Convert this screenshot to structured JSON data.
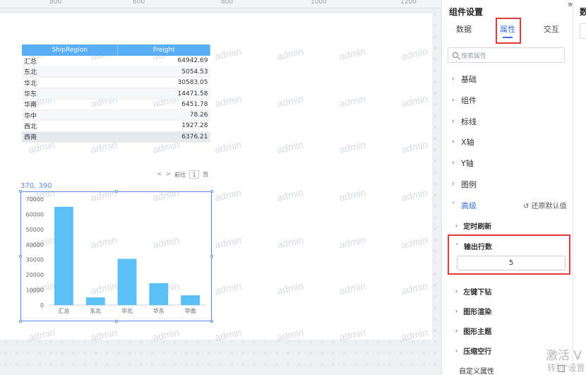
{
  "ruler": {
    "marks": [
      "800",
      "600",
      "800",
      "1000",
      "1200"
    ]
  },
  "watermark": "admin",
  "table": {
    "headers": [
      "ShipRegion",
      "Freight"
    ],
    "rows": [
      [
        "汇总",
        "64942.69"
      ],
      [
        "东北",
        "5054.53"
      ],
      [
        "华北",
        "30583.05"
      ],
      [
        "华东",
        "14471.58"
      ],
      [
        "华南",
        "6451.78"
      ],
      [
        "华中",
        "78.26"
      ],
      [
        "西北",
        "1927.28"
      ],
      [
        "西南",
        "6376.21"
      ]
    ]
  },
  "pager": {
    "prev": "<",
    "next": ">",
    "goto_label": "前往",
    "page_value": "1",
    "page_suffix": "页"
  },
  "selection_coord": "370, 390",
  "chart_data": {
    "type": "bar",
    "categories": [
      "汇总",
      "东北",
      "华北",
      "华东",
      "华南"
    ],
    "values": [
      64942.69,
      5054.53,
      30583.05,
      14471.58,
      6451.78
    ],
    "ylim": [
      0,
      70000
    ],
    "yticks": [
      "70000",
      "60000",
      "50000",
      "40000",
      "30000",
      "20000",
      "10000",
      "0"
    ],
    "color": "#5bc0f5",
    "title": "",
    "xlabel": "",
    "ylabel": ""
  },
  "panel": {
    "title": "组件设置",
    "tabs": [
      "数据",
      "属性",
      "交互"
    ],
    "active_tab": "属性",
    "search_placeholder": "搜索属性",
    "sections": [
      "基础",
      "组件",
      "标线",
      "X轴",
      "Y轴",
      "图例",
      "高级"
    ],
    "restore_label": "还原默认值",
    "advanced_items": [
      "定时刷新",
      "输出行数",
      "左键下钻",
      "图形渲染",
      "图形主题",
      "压缩空行"
    ],
    "output_rows_value": "5",
    "custom_attr_label": "自定义属性"
  },
  "right_strip": {
    "title": "数",
    "collapse_glyph": "»"
  },
  "activate_text": "激活 V",
  "activate_sub": "转到\"设置"
}
